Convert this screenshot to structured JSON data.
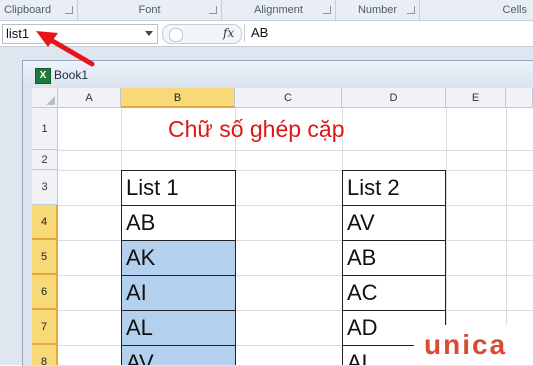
{
  "ribbon": {
    "groups": [
      "Clipboard",
      "Font",
      "Alignment",
      "Number",
      "Cells"
    ]
  },
  "formula_bar": {
    "name_box": "list1",
    "fx_icon": "fx",
    "formula": "AB"
  },
  "workbook": {
    "title": "Book1",
    "icon": "excel-workbook-icon"
  },
  "sheet": {
    "columns": [
      "A",
      "B",
      "C",
      "D",
      "E"
    ],
    "rows": [
      "1",
      "2",
      "3",
      "4",
      "5",
      "6",
      "7",
      "8"
    ],
    "title_text": "Chữ số ghép cặp",
    "list1": {
      "header": "List 1",
      "items": [
        "AB",
        "AK",
        "AI",
        "AL",
        "AV"
      ]
    },
    "list2": {
      "header": "List 2",
      "items": [
        "AV",
        "AB",
        "AC",
        "AD",
        "AL"
      ]
    }
  },
  "annotation": {
    "arrow_color": "#e8141b",
    "icon": "red-arrow-icon"
  },
  "watermark": {
    "text": "unica"
  },
  "colors": {
    "title": "#e01616",
    "selection": "#b3d1ee",
    "header_selected": "#f8d978"
  }
}
